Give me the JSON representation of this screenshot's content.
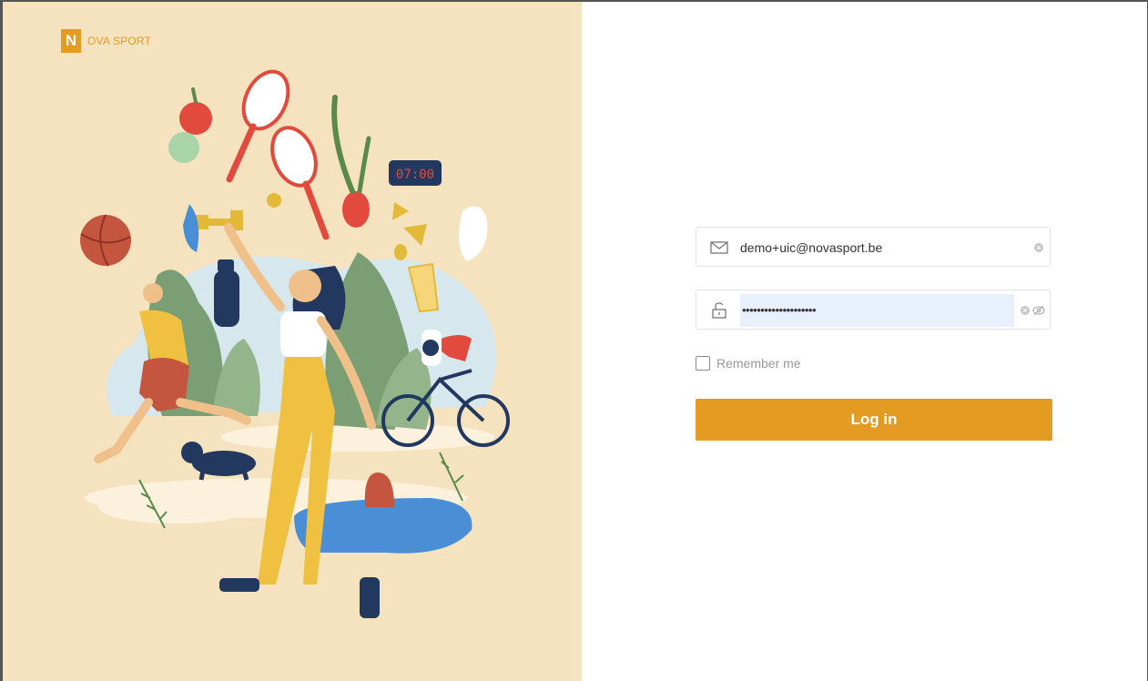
{
  "brand": {
    "mark": "N",
    "name": "OVA SPORT"
  },
  "illustration": {
    "clock_text": "07:00"
  },
  "login": {
    "email_value": "demo+uic@novasport.be",
    "password_mask": "••••••••••••••••••••",
    "remember_label": "Remember me",
    "remember_checked": false,
    "submit_label": "Log in"
  },
  "colors": {
    "accent": "#e39b22",
    "panel_bg": "#f5e3c0",
    "autofill_bg": "#e8f0fe"
  },
  "icons": [
    "mail-icon",
    "unlock-icon",
    "clear-icon",
    "eye-off-icon"
  ]
}
